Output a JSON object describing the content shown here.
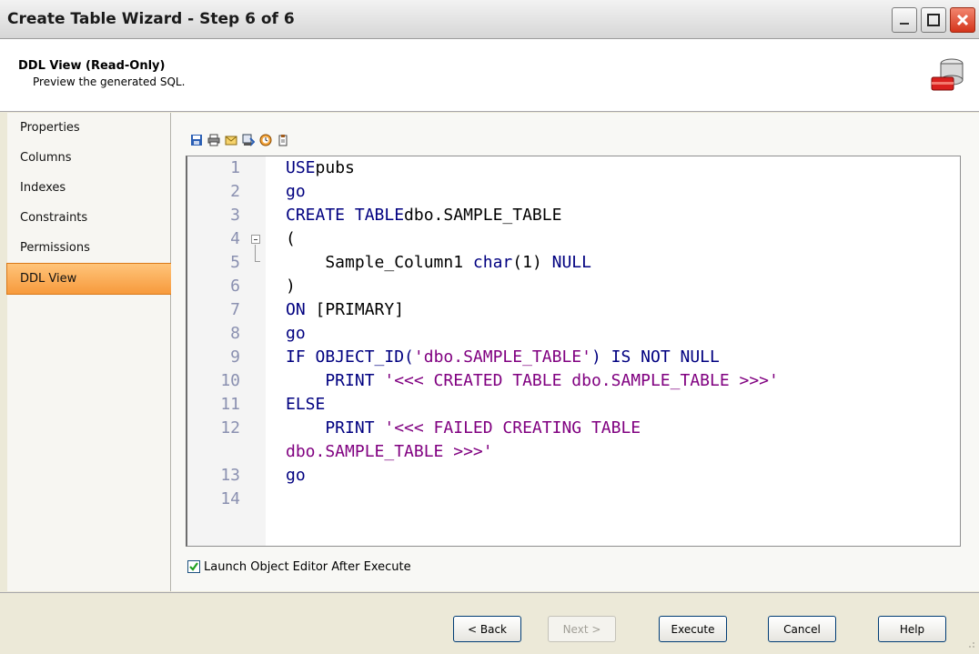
{
  "window": {
    "title": "Create Table Wizard - Step 6 of 6"
  },
  "header": {
    "title": "DDL View (Read-Only)",
    "subtitle": "Preview the generated SQL."
  },
  "sidebar": {
    "items": [
      {
        "label": "Properties"
      },
      {
        "label": "Columns"
      },
      {
        "label": "Indexes"
      },
      {
        "label": "Constraints"
      },
      {
        "label": "Permissions"
      },
      {
        "label": "DDL View",
        "active": true
      }
    ]
  },
  "toolbar": {
    "icons": [
      "save-icon",
      "print-icon",
      "email-icon",
      "sql-export-icon",
      "schedule-icon",
      "copy-icon"
    ]
  },
  "editor": {
    "lines": [
      {
        "n": "1",
        "parts": [
          [
            "kw",
            "USE"
          ],
          [
            "",
            "pubs"
          ]
        ]
      },
      {
        "n": "2",
        "parts": [
          [
            "kw",
            "go"
          ]
        ]
      },
      {
        "n": "3",
        "parts": [
          [
            "kw",
            "CREATE TABLE"
          ],
          [
            "",
            "dbo.SAMPLE_TABLE"
          ]
        ]
      },
      {
        "n": "4",
        "parts": [
          [
            "",
            "("
          ]
        ]
      },
      {
        "n": "5",
        "parts": [
          [
            "",
            "    Sample_Column1 "
          ],
          [
            "kw",
            "char"
          ],
          [
            "",
            "(1) "
          ],
          [
            "kw",
            "NULL"
          ]
        ]
      },
      {
        "n": "6",
        "parts": [
          [
            "",
            ")"
          ]
        ]
      },
      {
        "n": "7",
        "parts": [
          [
            "kw",
            "ON"
          ],
          [
            "",
            " [PRIMARY]"
          ]
        ]
      },
      {
        "n": "8",
        "parts": [
          [
            "kw",
            "go"
          ]
        ]
      },
      {
        "n": "9",
        "parts": [
          [
            "kw",
            "IF OBJECT_ID("
          ],
          [
            "str",
            "'dbo.SAMPLE_TABLE'"
          ],
          [
            "kw",
            ") IS NOT NULL"
          ]
        ]
      },
      {
        "n": "10",
        "parts": [
          [
            "kw",
            "    PRINT "
          ],
          [
            "str",
            "'<<< CREATED TABLE dbo.SAMPLE_TABLE >>>'"
          ]
        ]
      },
      {
        "n": "11",
        "parts": [
          [
            "kw",
            "ELSE"
          ]
        ]
      },
      {
        "n": "12",
        "parts": [
          [
            "kw",
            "    PRINT "
          ],
          [
            "str",
            "'<<< FAILED CREATING TABLE"
          ]
        ]
      },
      {
        "n": "",
        "parts": [
          [
            "str",
            "dbo.SAMPLE_TABLE >>>'"
          ]
        ]
      },
      {
        "n": "13",
        "parts": [
          [
            "kw",
            "go"
          ]
        ]
      },
      {
        "n": "14",
        "parts": []
      }
    ]
  },
  "options": {
    "launch_editor_label": "Launch Object Editor After Execute",
    "launch_editor_checked": true
  },
  "buttons": {
    "back": "< Back",
    "next": "Next >",
    "execute": "Execute",
    "cancel": "Cancel",
    "help": "Help"
  },
  "colors": {
    "accent": "#f79a3c",
    "keyword": "#000080",
    "string": "#800080"
  }
}
